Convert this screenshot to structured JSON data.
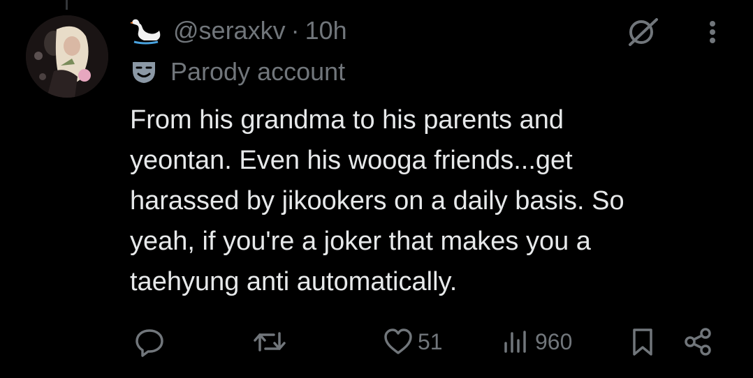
{
  "tweet": {
    "handle": "@seraxkv",
    "separator": "·",
    "time": "10h",
    "account_label": "Parody account",
    "text": "From his grandma to his parents and\nyeontan. Even his wooga friends...get\nharassed by jikookers on a daily basis. So\nyeah, if you're a joker that makes you a\ntaehyung anti automatically."
  },
  "icons": {
    "header_badge": "swan-icon",
    "parody": "theater-mask-icon",
    "grok": "grok-icon",
    "more": "more-vertical-icon",
    "reply": "reply-icon",
    "retweet": "retweet-icon",
    "like": "heart-icon",
    "views": "analytics-icon",
    "bookmark": "bookmark-icon",
    "share": "share-icon"
  },
  "metrics": {
    "replies": "",
    "retweets": "",
    "likes": "51",
    "views": "960"
  },
  "colors": {
    "background": "#000000",
    "text_primary": "#e7e9ea",
    "text_secondary": "#71767b",
    "thread_line": "#333639"
  }
}
